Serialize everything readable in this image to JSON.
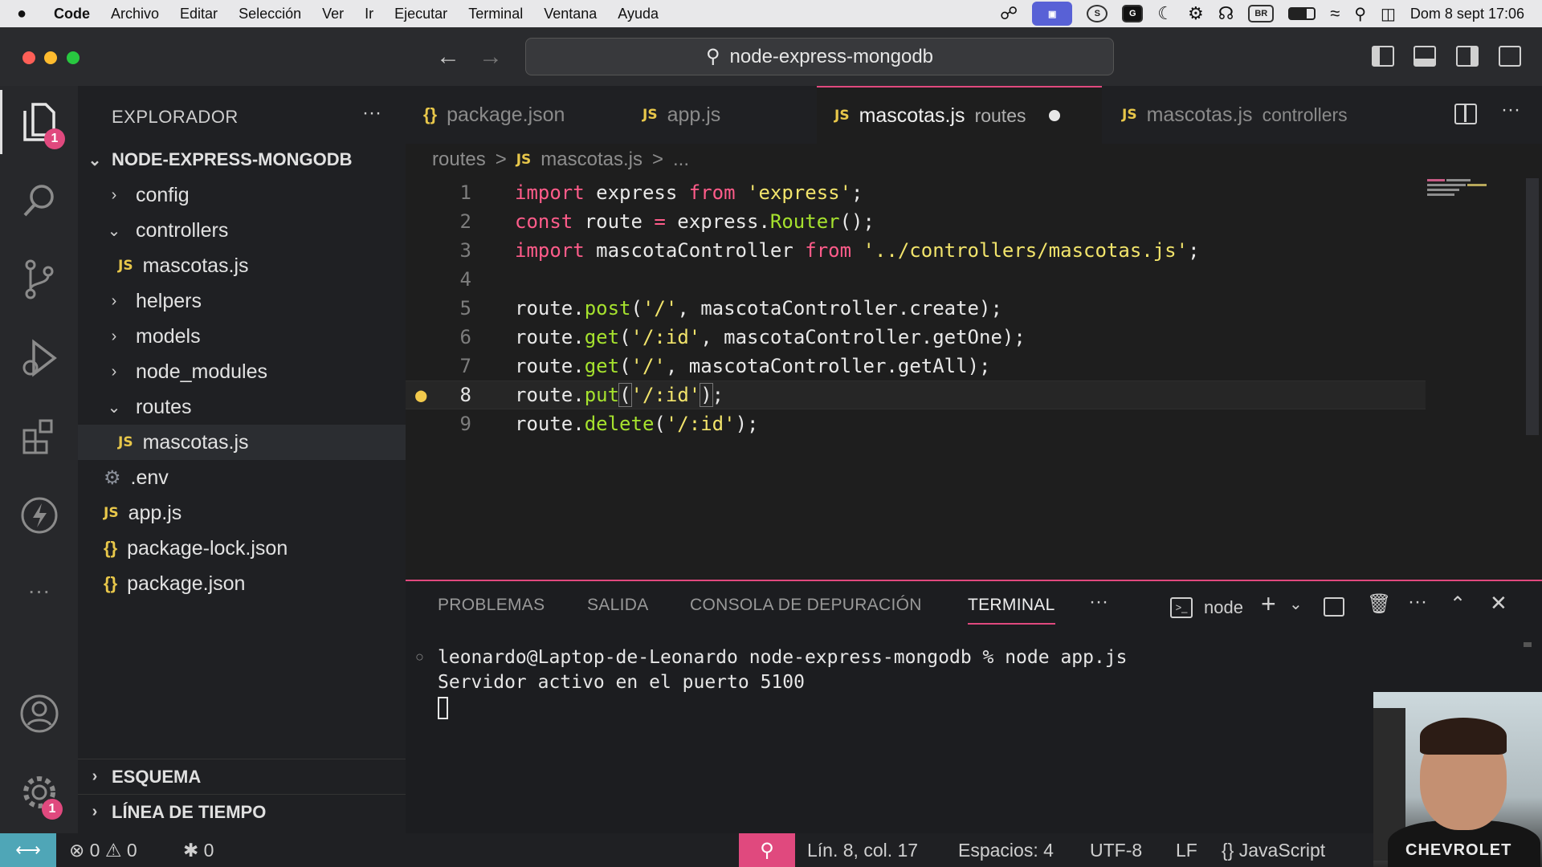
{
  "menubar": {
    "apple": "",
    "items": [
      "Code",
      "Archivo",
      "Editar",
      "Selección",
      "Ver",
      "Ir",
      "Ejecutar",
      "Terminal",
      "Ventana",
      "Ayuda"
    ],
    "status_icons": [
      "S",
      "G",
      "BR"
    ],
    "clock": "Dom 8 sept  17:06"
  },
  "window": {
    "search_text": "node-express-mongodb"
  },
  "activity": {
    "explorer_badge": "1",
    "settings_badge": "1"
  },
  "sidebar": {
    "title": "EXPLORADOR",
    "more": "···",
    "root": "NODE-EXPRESS-MONGODB",
    "items": [
      {
        "label": "config",
        "type": "folder",
        "open": false
      },
      {
        "label": "controllers",
        "type": "folder",
        "open": true
      },
      {
        "label": "mascotas.js",
        "type": "js"
      },
      {
        "label": "helpers",
        "type": "folder",
        "open": false
      },
      {
        "label": "models",
        "type": "folder",
        "open": false
      },
      {
        "label": "node_modules",
        "type": "folder",
        "open": false
      },
      {
        "label": "routes",
        "type": "folder",
        "open": true
      },
      {
        "label": "mascotas.js",
        "type": "js"
      },
      {
        "label": ".env",
        "type": "env"
      },
      {
        "label": "app.js",
        "type": "js"
      },
      {
        "label": "package-lock.json",
        "type": "json"
      },
      {
        "label": "package.json",
        "type": "json"
      }
    ],
    "sections": [
      "ESQUEMA",
      "LÍNEA DE TIEMPO"
    ]
  },
  "tabs": [
    {
      "icon": "{}",
      "label": "package.json",
      "desc": ""
    },
    {
      "icon": "JS",
      "label": "app.js",
      "desc": ""
    },
    {
      "icon": "JS",
      "label": "mascotas.js",
      "desc": "routes",
      "active": true,
      "modified": true
    },
    {
      "icon": "JS",
      "label": "mascotas.js",
      "desc": "controllers"
    }
  ],
  "breadcrumb": {
    "folder": "routes",
    "sep1": ">",
    "icon": "JS",
    "file": "mascotas.js",
    "sep2": ">",
    "rest": "..."
  },
  "editor": {
    "current_line": 8,
    "line_numbers": [
      "1",
      "2",
      "3",
      "4",
      "5",
      "6",
      "7",
      "8",
      "9"
    ]
  },
  "panel": {
    "tabs": [
      "PROBLEMAS",
      "SALIDA",
      "CONSOLA DE DEPURACIÓN",
      "TERMINAL"
    ],
    "active_tab": "TERMINAL",
    "more": "···",
    "shell": "node",
    "terminal_lines": [
      "leonardo@Laptop-de-Leonardo node-express-mongodb % node app.js",
      "Servidor activo en el puerto 5100"
    ]
  },
  "status": {
    "errors": "0",
    "warnings": "0",
    "ports": "0",
    "position": "Lín. 8, col. 17",
    "spaces": "Espacios: 4",
    "encoding": "UTF-8",
    "eol": "LF",
    "language": "JavaScript"
  },
  "webcam": {
    "shirt_text": "CHEVROLET"
  },
  "colors": {
    "accent": "#e0497e",
    "keyword": "#ff5c8a",
    "function": "#a6e22e",
    "string": "#f2e46b",
    "js_icon": "#e8c74a"
  }
}
